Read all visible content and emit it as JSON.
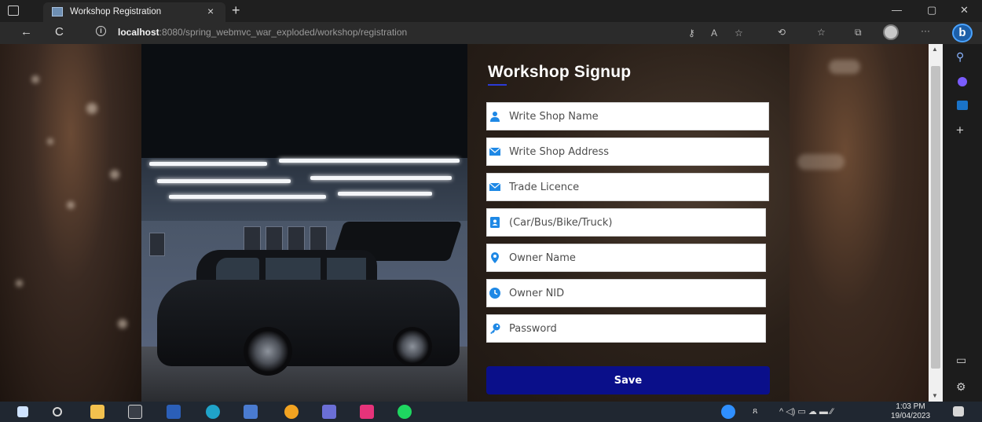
{
  "browser": {
    "tab_title": "Workshop Registration",
    "tab_close": "×",
    "new_tab": "+",
    "minimize": "—",
    "restore": "▢",
    "close": "✕",
    "back": "←",
    "reload": "C",
    "url_host": "localhost",
    "url_path": ":8080/spring_webmvc_war_exploded/workshop/registration",
    "address_icons": [
      "key-icon",
      "read-aloud-icon",
      "favorite-star-icon",
      "extensions-icon",
      "favorites-icon",
      "collections-icon",
      "profile-icon",
      "more-icon"
    ],
    "more": "···",
    "bing": "b"
  },
  "form": {
    "title": "Workshop Signup",
    "fields": [
      {
        "placeholder": "Write Shop Name",
        "icon": "user-icon",
        "icon_color": "#1e88e5"
      },
      {
        "placeholder": "Write Shop Address",
        "icon": "envelope-icon",
        "icon_color": "#1e88e5"
      },
      {
        "placeholder": "Trade Licence",
        "icon": "envelope-icon",
        "icon_color": "#1e88e5"
      },
      {
        "placeholder": "(Car/Bus/Bike/Truck)",
        "icon": "contact-card-icon",
        "icon_color": "#1e88e5"
      },
      {
        "placeholder": "Owner Name",
        "icon": "map-pin-icon",
        "icon_color": "#1e88e5"
      },
      {
        "placeholder": "Owner NID",
        "icon": "clock-icon",
        "icon_color": "#1e88e5"
      },
      {
        "placeholder": "Password",
        "icon": "key-icon",
        "icon_color": "#1e88e5"
      }
    ],
    "save_label": "Save",
    "save_color": "#0a0f8a"
  },
  "sidebar": {
    "search": "⚲",
    "add": "+",
    "split": "▭",
    "settings": "⚙"
  },
  "taskbar": {
    "time": "1:03 PM",
    "date": "19/04/2023",
    "tray_text": "^ ◁) ▭ ☁ ▬ ⁄⁄"
  }
}
